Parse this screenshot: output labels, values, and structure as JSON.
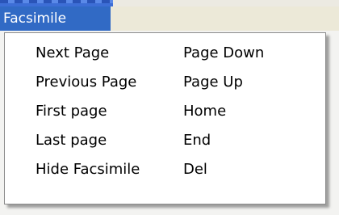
{
  "menu": {
    "title": "Facsimile",
    "items": [
      {
        "label": "Next Page",
        "shortcut": "Page Down"
      },
      {
        "label": "Previous Page",
        "shortcut": "Page Up"
      },
      {
        "label": "First page",
        "shortcut": "Home"
      },
      {
        "label": "Last page",
        "shortcut": "End"
      },
      {
        "label": "Hide Facsimile",
        "shortcut": "Del"
      }
    ]
  },
  "colors": {
    "highlight": "#316ac5",
    "menu_background": "#ffffff",
    "menubar_background": "#ece9d8"
  }
}
